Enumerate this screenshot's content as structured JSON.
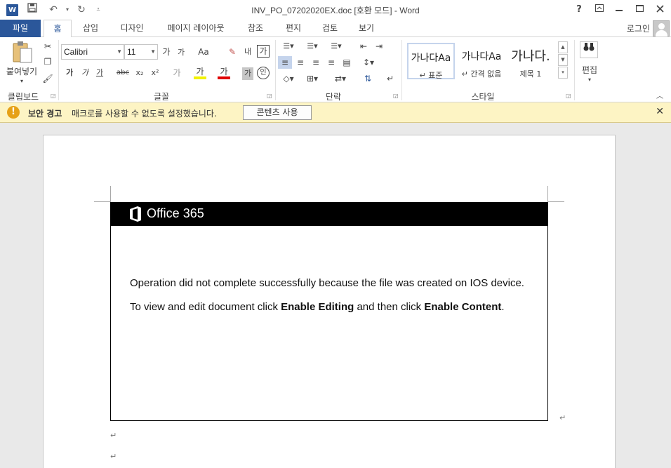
{
  "app": {
    "logo_letter": "W",
    "title": "INV_PO_07202020EX.doc [호환 모드] - Word",
    "quick_access": {
      "undo_icon": "undo-icon",
      "redo_icon": "redo-icon"
    },
    "window_buttons": {
      "help": "?",
      "restore_ribbon": "⊡",
      "minimize": "—",
      "maximize": "☐",
      "close": "✕"
    }
  },
  "tabs": [
    "파일",
    "홈",
    "삽입",
    "디자인",
    "페이지 레이아웃",
    "참조",
    "편지",
    "검토",
    "보기"
  ],
  "account": {
    "login_label": "로그인"
  },
  "ribbon": {
    "clipboard": {
      "paste_label": "붙여넣기",
      "group_label": "클립보드"
    },
    "font": {
      "font_name": "Calibri",
      "font_size": "11",
      "grow": "가",
      "shrink": "가",
      "change_case": "Aa",
      "clear_format_label": "내",
      "phonetic": "가",
      "bold": "가",
      "italic": "가",
      "underline": "가",
      "strike": "abc",
      "subscript": "x₂",
      "superscript": "x²",
      "effects": "가",
      "highlight": "가",
      "font_color": "가",
      "char_shading": "가",
      "enclosed": "인",
      "group_label": "글꼴"
    },
    "paragraph": {
      "group_label": "단락"
    },
    "styles": {
      "items": [
        {
          "preview": "가나다Aa",
          "name": "↵ 표준"
        },
        {
          "preview": "가나다Aa",
          "name": "↵ 간격 없음"
        },
        {
          "preview": "가나다.",
          "name": "제목 1"
        }
      ],
      "group_label": "스타일"
    },
    "editing": {
      "label": "편집"
    }
  },
  "message_bar": {
    "title": "보안 경고",
    "text": "매크로를 사용할 수 없도록 설정했습니다.",
    "button": "콘텐츠 사용",
    "close": "✕"
  },
  "document": {
    "logo_text": "Office 365",
    "line1": "Operation did not complete successfully because the file was created on IOS device.",
    "line2_pre": "To view and edit document click ",
    "line2_bold1": "Enable Editing",
    "line2_mid": " and then click ",
    "line2_bold2": "Enable Content",
    "line2_post": ".",
    "paragraph_mark": "↵"
  },
  "colors": {
    "word_blue": "#2b579a",
    "warning_bg": "#fdf4c4",
    "warning_icon": "#e6a117"
  }
}
